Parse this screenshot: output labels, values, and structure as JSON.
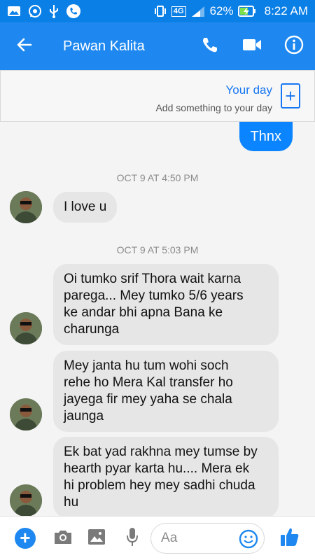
{
  "status_bar": {
    "network": "4G",
    "battery": "62%",
    "time": "8:22 AM"
  },
  "header": {
    "contact_name": "Pawan Kalita"
  },
  "your_day": {
    "title": "Your day",
    "subtitle": "Add something to your day"
  },
  "messages": {
    "outgoing_1": "Thnx",
    "timestamp_1": "OCT 9 AT 4:50 PM",
    "incoming_1": "I love u",
    "timestamp_2": "OCT 9 AT 5:03 PM",
    "incoming_2_lines": [
      "Oi tumko srif Thora wait karna",
      "parega... Mey tumko 5/6 years",
      "ke andar bhi apna Bana ke",
      "charunga"
    ],
    "incoming_3_lines": [
      "Mey janta hu tum wohi soch",
      "rehe ho Mera Kal transfer ho",
      "jayega fir mey yaha se chala",
      "jaunga"
    ],
    "incoming_4_lines": [
      "Ek bat yad rakhna mey tumse by",
      "hearth pyar karta hu.... Mera ek",
      "hi problem hey mey sadhi chuda",
      "hu"
    ]
  },
  "composer": {
    "placeholder": "Aa"
  },
  "colors": {
    "header": "#1e88f0",
    "status_bar": "#0a7fe6",
    "outgoing_bubble": "#0a84ff",
    "incoming_bubble": "#e6e6e6"
  }
}
